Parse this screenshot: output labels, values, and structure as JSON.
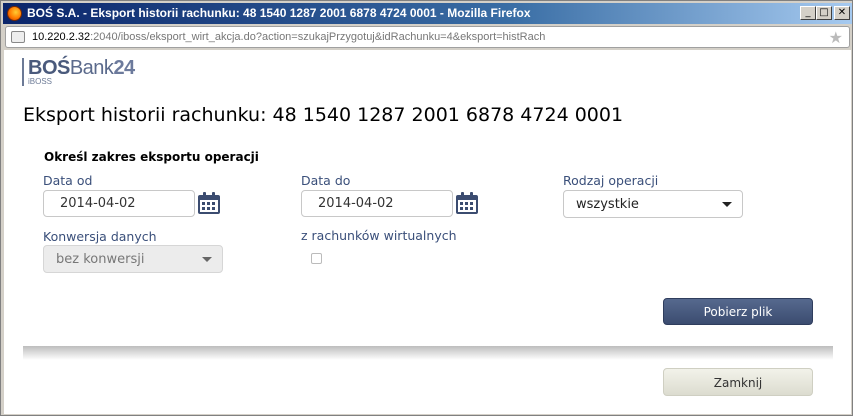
{
  "window": {
    "title": "BOŚ S.A. - Eksport historii rachunku: 48 1540 1287 2001 6878 4724 0001 - Mozilla Firefox",
    "min_label": "_",
    "max_label": "□",
    "close_label": "✕"
  },
  "urlbar": {
    "host": "10.220.2.32",
    "path": ":2040/iboss/eksport_wirt_akcja.do?action=szukajPrzygotuj&idRachunku=4&eksport=histRach"
  },
  "logo": {
    "bos": "BOŚ",
    "bank": "Bank",
    "num": "24",
    "sub": "iBOSS"
  },
  "page": {
    "title": "Eksport historii rachunku: 48 1540 1287 2001 6878 4724 0001"
  },
  "form": {
    "section_title": "Określ zakres eksportu operacji",
    "date_from": {
      "label": "Data od",
      "value": "2014-04-02"
    },
    "date_to": {
      "label": "Data do",
      "value": "2014-04-02"
    },
    "operation_type": {
      "label": "Rodzaj operacji",
      "value": "wszystkie"
    },
    "conversion": {
      "label": "Konwersja danych",
      "value": "bez konwersji"
    },
    "virtual_accounts": {
      "label": "z rachunków wirtualnych",
      "checked": false
    }
  },
  "buttons": {
    "download": "Pobierz plik",
    "close": "Zamknij"
  },
  "colors": {
    "primary_button": "#3b4c70",
    "label_text": "#3a4f7a",
    "calendar_icon": "#3b4c70"
  }
}
